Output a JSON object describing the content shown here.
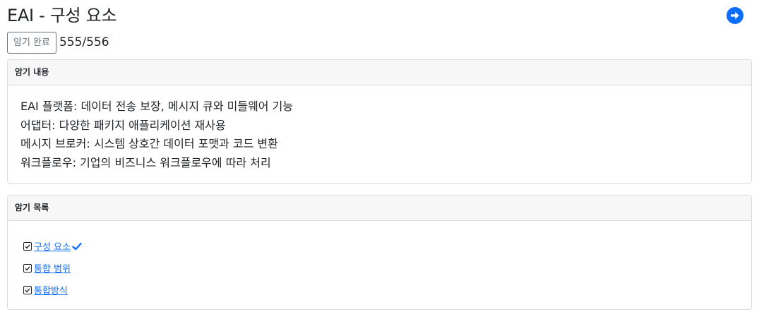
{
  "header": {
    "title": "EAI - 구성 요소",
    "next_icon": "arrow-circle-right-icon",
    "accent_color": "#0d6efd"
  },
  "status": {
    "done_button_label": "암기 완료",
    "progress": "555/556"
  },
  "content_card": {
    "header": "암기 내용",
    "lines": [
      "EAI 플랫폼: 데이터 전송 보장, 메시지 큐와 미들웨어 기능",
      "어댑터: 다양한 패키지 애플리케이션 재사용",
      "메시지 브로커: 시스템 상호간 데이터 포맷과 코드 변환",
      "워크플로우: 기업의 비즈니스 워크플로우에 따라 처리"
    ]
  },
  "list_card": {
    "header": "암기 목록",
    "items": [
      {
        "label": "구성 요소",
        "checked": true,
        "current": true
      },
      {
        "label": "통합 범위",
        "checked": true,
        "current": false
      },
      {
        "label": "통합방식",
        "checked": true,
        "current": false
      }
    ]
  }
}
